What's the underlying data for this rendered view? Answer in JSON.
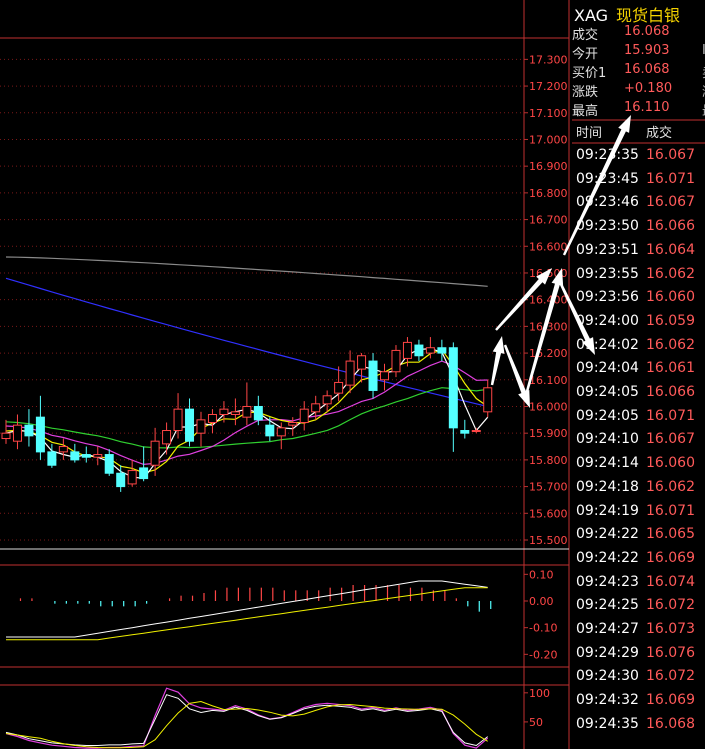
{
  "colors": {
    "background": "#000000",
    "up": "#ff4646",
    "down": "#54ffff",
    "frame": "#c03030",
    "ma_gray": "#8a8a8a",
    "ma_blue": "#3030ff",
    "ma_green": "#30d030",
    "ma_magenta": "#e040e0",
    "ma_yellow": "#f0f000",
    "ma_white": "#ffffff",
    "arrow": "#ffffff"
  },
  "quote": {
    "symbol": "XAG",
    "name": "现货白银",
    "rows": [
      {
        "label": "成交",
        "value": "16.068",
        "extra": ""
      },
      {
        "label": "今开",
        "value": "15.903",
        "extra": "I"
      },
      {
        "label": "买价1",
        "value": "16.068",
        "extra": "卖"
      },
      {
        "label": "涨跌",
        "value": "+0.180",
        "extra": "涨"
      },
      {
        "label": "最高",
        "value": "16.110",
        "extra": "最"
      }
    ],
    "ticks_header": {
      "time": "时间",
      "price": "成交"
    },
    "ticks": [
      {
        "time": "09:23:35",
        "price": "16.067"
      },
      {
        "time": "09:23:45",
        "price": "16.071"
      },
      {
        "time": "09:23:46",
        "price": "16.067"
      },
      {
        "time": "09:23:50",
        "price": "16.066"
      },
      {
        "time": "09:23:51",
        "price": "16.064"
      },
      {
        "time": "09:23:55",
        "price": "16.062"
      },
      {
        "time": "09:23:56",
        "price": "16.060"
      },
      {
        "time": "09:24:00",
        "price": "16.059"
      },
      {
        "time": "09:24:02",
        "price": "16.062"
      },
      {
        "time": "09:24:04",
        "price": "16.061"
      },
      {
        "time": "09:24:05",
        "price": "16.066"
      },
      {
        "time": "09:24:05",
        "price": "16.071"
      },
      {
        "time": "09:24:10",
        "price": "16.067"
      },
      {
        "time": "09:24:14",
        "price": "16.060"
      },
      {
        "time": "09:24:18",
        "price": "16.062"
      },
      {
        "time": "09:24:19",
        "price": "16.071"
      },
      {
        "time": "09:24:22",
        "price": "16.065"
      },
      {
        "time": "09:24:22",
        "price": "16.069"
      },
      {
        "time": "09:24:23",
        "price": "16.074"
      },
      {
        "time": "09:24:25",
        "price": "16.072"
      },
      {
        "time": "09:24:27",
        "price": "16.073"
      },
      {
        "time": "09:24:29",
        "price": "16.076"
      },
      {
        "time": "09:24:30",
        "price": "16.072"
      },
      {
        "time": "09:24:32",
        "price": "16.069"
      },
      {
        "time": "09:24:35",
        "price": "16.068"
      }
    ]
  },
  "chart_data": [
    {
      "type": "candlestick",
      "ylim": [
        15.47,
        17.38
      ],
      "yticks": [
        "17.300",
        "17.200",
        "17.100",
        "17.000",
        "16.900",
        "16.800",
        "16.700",
        "16.600",
        "16.500",
        "16.400",
        "16.300",
        "16.200",
        "16.100",
        "16.000",
        "15.900",
        "15.800",
        "15.700",
        "15.600",
        "15.500"
      ],
      "ytick_values": [
        17.3,
        17.2,
        17.1,
        17.0,
        16.9,
        16.8,
        16.7,
        16.6,
        16.5,
        16.4,
        16.3,
        16.2,
        16.1,
        16.0,
        15.9,
        15.8,
        15.7,
        15.6,
        15.5
      ],
      "candles": [
        {
          "o": 15.88,
          "h": 15.95,
          "l": 15.86,
          "c": 15.9
        },
        {
          "o": 15.87,
          "h": 15.97,
          "l": 15.84,
          "c": 15.93
        },
        {
          "o": 15.93,
          "h": 15.99,
          "l": 15.85,
          "c": 15.89
        },
        {
          "o": 15.96,
          "h": 16.04,
          "l": 15.8,
          "c": 15.83
        },
        {
          "o": 15.83,
          "h": 15.86,
          "l": 15.77,
          "c": 15.78
        },
        {
          "o": 15.83,
          "h": 15.88,
          "l": 15.8,
          "c": 15.85
        },
        {
          "o": 15.83,
          "h": 15.86,
          "l": 15.79,
          "c": 15.8
        },
        {
          "o": 15.82,
          "h": 15.85,
          "l": 15.79,
          "c": 15.81
        },
        {
          "o": 15.81,
          "h": 15.85,
          "l": 15.78,
          "c": 15.82
        },
        {
          "o": 15.82,
          "h": 15.84,
          "l": 15.74,
          "c": 15.75
        },
        {
          "o": 15.75,
          "h": 15.78,
          "l": 15.68,
          "c": 15.7
        },
        {
          "o": 15.71,
          "h": 15.8,
          "l": 15.7,
          "c": 15.76
        },
        {
          "o": 15.77,
          "h": 15.85,
          "l": 15.72,
          "c": 15.73
        },
        {
          "o": 15.78,
          "h": 15.92,
          "l": 15.74,
          "c": 15.87
        },
        {
          "o": 15.86,
          "h": 15.94,
          "l": 15.82,
          "c": 15.91
        },
        {
          "o": 15.91,
          "h": 16.05,
          "l": 15.88,
          "c": 15.99
        },
        {
          "o": 15.99,
          "h": 16.03,
          "l": 15.85,
          "c": 15.87
        },
        {
          "o": 15.9,
          "h": 15.98,
          "l": 15.85,
          "c": 15.95
        },
        {
          "o": 15.94,
          "h": 15.99,
          "l": 15.9,
          "c": 15.97
        },
        {
          "o": 15.97,
          "h": 16.02,
          "l": 15.94,
          "c": 15.99
        },
        {
          "o": 15.97,
          "h": 16.03,
          "l": 15.93,
          "c": 15.98
        },
        {
          "o": 15.96,
          "h": 16.09,
          "l": 15.93,
          "c": 16.0
        },
        {
          "o": 16.0,
          "h": 16.04,
          "l": 15.93,
          "c": 15.95
        },
        {
          "o": 15.93,
          "h": 15.96,
          "l": 15.87,
          "c": 15.89
        },
        {
          "o": 15.89,
          "h": 15.94,
          "l": 15.84,
          "c": 15.92
        },
        {
          "o": 15.93,
          "h": 15.96,
          "l": 15.89,
          "c": 15.94
        },
        {
          "o": 15.94,
          "h": 16.02,
          "l": 15.91,
          "c": 15.99
        },
        {
          "o": 15.98,
          "h": 16.04,
          "l": 15.95,
          "c": 16.01
        },
        {
          "o": 16.01,
          "h": 16.06,
          "l": 15.98,
          "c": 16.04
        },
        {
          "o": 16.05,
          "h": 16.15,
          "l": 16.02,
          "c": 16.09
        },
        {
          "o": 16.08,
          "h": 16.21,
          "l": 16.05,
          "c": 16.17
        },
        {
          "o": 16.14,
          "h": 16.2,
          "l": 16.09,
          "c": 16.19
        },
        {
          "o": 16.17,
          "h": 16.2,
          "l": 16.03,
          "c": 16.06
        },
        {
          "o": 16.1,
          "h": 16.16,
          "l": 16.06,
          "c": 16.13
        },
        {
          "o": 16.13,
          "h": 16.23,
          "l": 16.11,
          "c": 16.21
        },
        {
          "o": 16.18,
          "h": 16.26,
          "l": 16.15,
          "c": 16.24
        },
        {
          "o": 16.23,
          "h": 16.25,
          "l": 16.17,
          "c": 16.19
        },
        {
          "o": 16.2,
          "h": 16.26,
          "l": 16.18,
          "c": 16.22
        },
        {
          "o": 16.22,
          "h": 16.25,
          "l": 16.17,
          "c": 16.2
        },
        {
          "o": 16.22,
          "h": 16.24,
          "l": 15.83,
          "c": 15.92
        },
        {
          "o": 15.91,
          "h": 15.95,
          "l": 15.88,
          "c": 15.9
        },
        {
          "o": 15.91,
          "h": 15.92,
          "l": 15.9,
          "c": 15.91
        },
        {
          "o": 15.98,
          "h": 16.1,
          "l": 15.96,
          "c": 16.07
        }
      ]
    },
    {
      "type": "bar",
      "ylim": [
        -0.24,
        0.135
      ],
      "yticks": [
        "0.10",
        "0.00",
        "-0.10",
        "-0.20"
      ],
      "ytick_values": [
        0.1,
        0.0,
        -0.1,
        -0.2
      ],
      "values": [
        0.0,
        0.01,
        0.01,
        0.0,
        -0.01,
        -0.01,
        -0.01,
        -0.01,
        -0.02,
        -0.02,
        -0.02,
        -0.02,
        -0.01,
        0.0,
        0.01,
        0.02,
        0.02,
        0.03,
        0.04,
        0.05,
        0.05,
        0.05,
        0.05,
        0.05,
        0.04,
        0.04,
        0.04,
        0.04,
        0.05,
        0.05,
        0.06,
        0.06,
        0.06,
        0.06,
        0.06,
        0.05,
        0.05,
        0.04,
        0.04,
        0.01,
        -0.02,
        -0.04,
        -0.03
      ]
    },
    {
      "type": "line",
      "ylim": [
        0,
        110
      ],
      "yticks": [
        "100",
        "50"
      ],
      "ytick_values": [
        100,
        50
      ]
    }
  ],
  "annotation_arrows": 6
}
